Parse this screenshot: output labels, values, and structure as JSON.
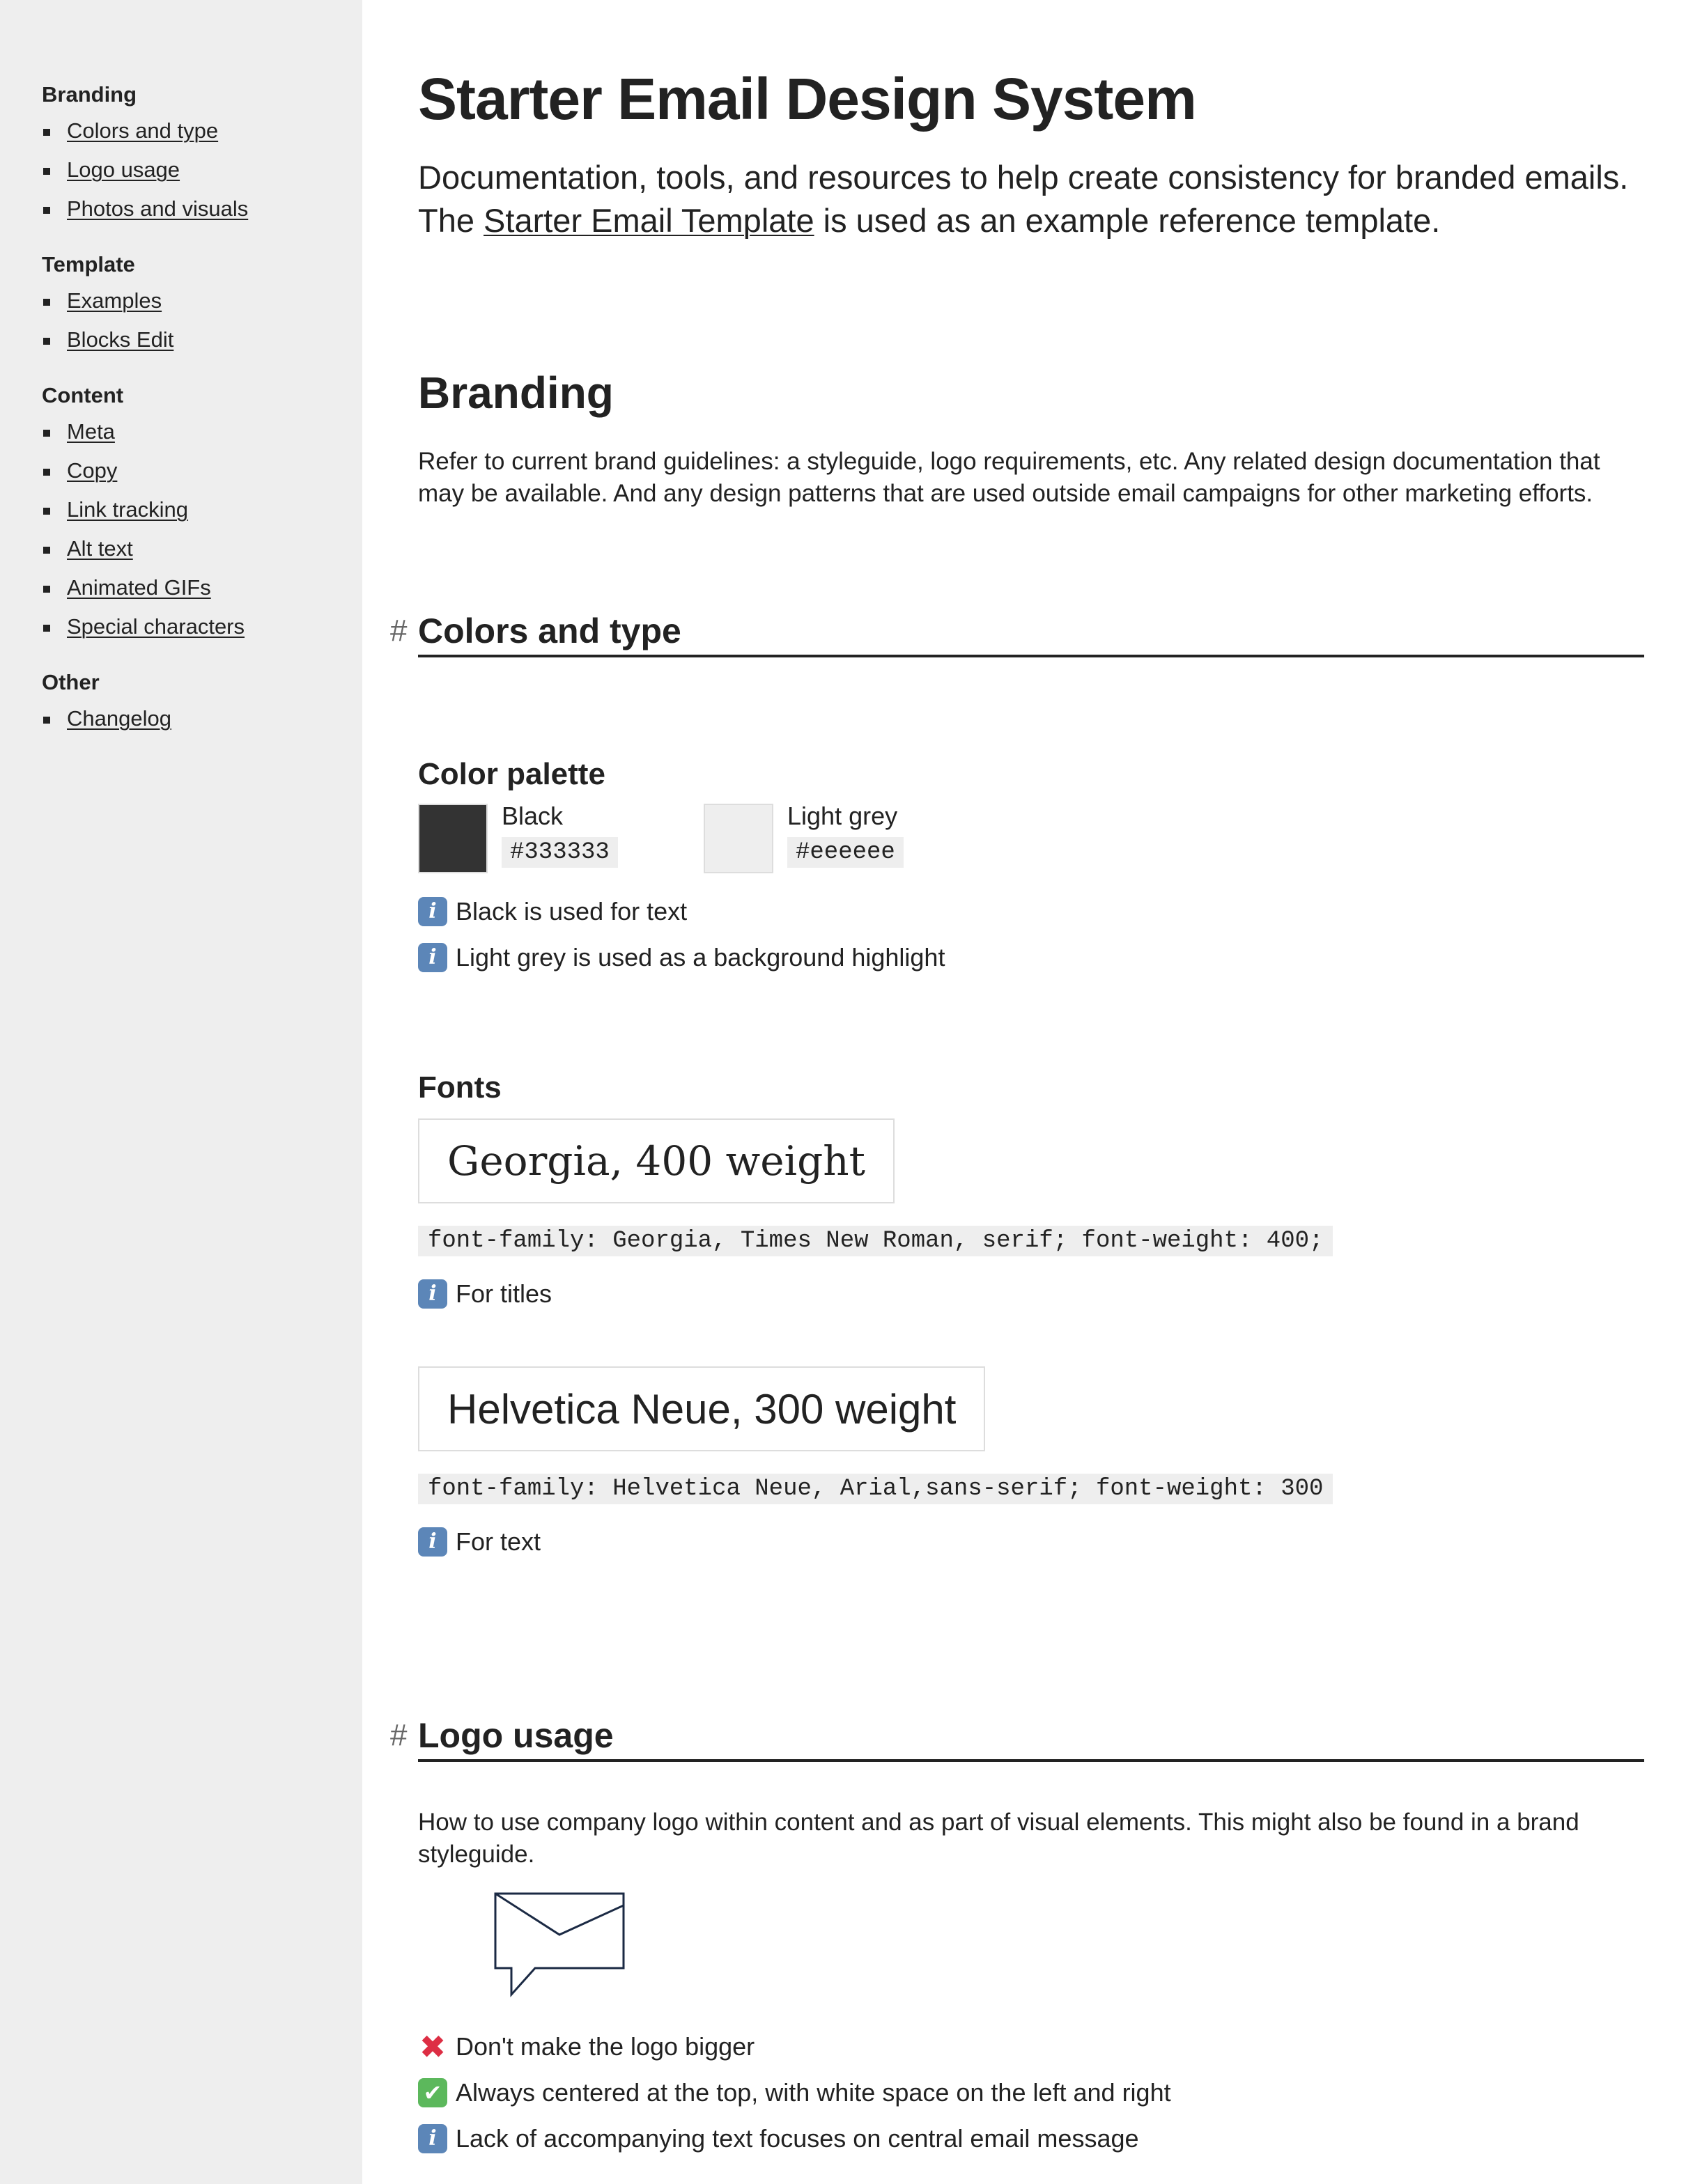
{
  "sidebar": {
    "groups": [
      {
        "title": "Branding",
        "items": [
          "Colors and type",
          "Logo usage",
          "Photos and visuals"
        ]
      },
      {
        "title": "Template",
        "items": [
          "Examples",
          "Blocks Edit"
        ]
      },
      {
        "title": "Content",
        "items": [
          "Meta",
          "Copy",
          "Link tracking",
          "Alt text",
          "Animated GIFs",
          "Special characters"
        ]
      },
      {
        "title": "Other",
        "items": [
          "Changelog"
        ]
      }
    ]
  },
  "page": {
    "title": "Starter Email Design System",
    "intro_line1": "Documentation, tools, and resources to help create consistency for branded emails.",
    "intro_line2_prefix": "The ",
    "intro_link": "Starter Email Template",
    "intro_line2_suffix": " is used as an example reference template."
  },
  "branding": {
    "heading": "Branding",
    "text": "Refer to current brand guidelines: a styleguide, logo requirements, etc. Any related design documentation that may be available. And any design patterns that are used outside email campaigns for other marketing efforts."
  },
  "colors_and_type": {
    "hash": "#",
    "heading": "Colors and type",
    "palette_heading": "Color palette",
    "swatches": [
      {
        "name": "Black",
        "code": "#333333",
        "color": "#333333"
      },
      {
        "name": "Light grey",
        "code": "#eeeeee",
        "color": "#eeeeee"
      }
    ],
    "palette_notes": [
      "Black is used for text",
      "Light grey is used as a background highlight"
    ],
    "fonts_heading": "Fonts",
    "fonts": [
      {
        "sample": "Georgia, 400 weight",
        "css": "font-family: Georgia, Times New Roman, serif; font-weight: 400;",
        "note": "For titles"
      },
      {
        "sample": "Helvetica Neue, 300 weight",
        "css": "font-family: Helvetica Neue, Arial,sans-serif; font-weight: 300",
        "note": "For text"
      }
    ]
  },
  "logo_usage": {
    "hash": "#",
    "heading": "Logo usage",
    "text": "How to use company logo within content and as part of visual elements. This might also be found in a brand styleguide.",
    "logo_icon": "envelope-speech-bubble-icon",
    "logo_stroke": "#1b2a44",
    "notes": [
      {
        "icon": "cross-mark-icon",
        "text": "Don't make the logo bigger"
      },
      {
        "icon": "check-mark-icon",
        "text": "Always centered at the top, with white space on the left and right"
      },
      {
        "icon": "info-icon",
        "text": "Lack of accompanying text focuses on central email message"
      }
    ]
  }
}
